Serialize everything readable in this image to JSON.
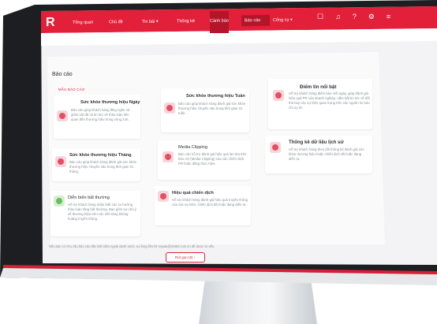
{
  "app": {
    "logo": "R"
  },
  "nav": {
    "items": [
      {
        "label": "Tổng quan"
      },
      {
        "label": "Chủ đề"
      },
      {
        "label": "Tin bài ▾"
      },
      {
        "label": "Thống kê"
      },
      {
        "label": "Cảnh báo"
      },
      {
        "label": "Báo cáo",
        "active": true
      },
      {
        "label": "Công cụ ▾"
      }
    ]
  },
  "page": {
    "title": "Báo cáo",
    "section_label": "MẪU BÁO CÁO"
  },
  "cards": [
    {
      "title": "Sức khỏe thương hiệu Ngày",
      "desc": "Báo cáo giúp khách hàng lắng nghe và giám sát tất cả tin tức về thảo luận liên quan đến thương hiệu trong vòng 24h."
    },
    {
      "title": "Sức khỏe thương hiệu Tuần",
      "desc": "Báo cáo giúp khách hàng đánh giá sức khỏe thương hiệu chuyên sâu trong thời gian 01 tuần."
    },
    {
      "title": "Điểm tin nổi bật",
      "desc": "Hỗ trợ khách hàng điểm báo mỗi ngày, giúp đánh giá hiệu quả PR của doanh nghiệp, nắm bắt tin tức về đối thủ hay các sự kiện quan trọng trên các nguồn tin báo chí uy tín."
    },
    {
      "title": "Sức khỏe thương hiệu Tháng",
      "desc": "Báo cáo giúp khách hàng đánh giá sức khỏe thương hiệu chuyên sâu trong thời gian 01 tháng."
    },
    {
      "title": "Media Clipping",
      "desc": "Báo cáo hỗ trợ đánh giá hiệu quả lan tỏa trên báo chí (Media Clipping) của các chiến dịch PR hoặc đăng thực hiện."
    },
    {
      "title": "Thống kê dữ liệu lịch sử",
      "desc": "Hỗ trợ khách hàng theo dõi thống kê đánh giá sức khỏe thương hiệu hoặc chiến dịch đã hoặc đang diễn ra."
    },
    {
      "title": "Diễn biến bất thường",
      "desc": "Hỗ trợ khách hàng nhận biết các xu hướng thảo luận tăng bất thường. Bao gồm sự chú ý về thương hiệu trên các nền tảng khủng hoảng truyền thông."
    },
    {
      "title": "Hiệu quả chiến dịch",
      "desc": "Hỗ trợ khách hàng đánh giá hiệu quả truyền thông của các sự kiện, chiến dịch đã hoặc đang diễn ra."
    }
  ],
  "footer": {
    "note": "Nếu bạn có nhu cầu báo cáo đặc biệt nằm ngoài danh sách, vui lòng liên hệ reputa@viettel.com.vn để được tư vấn.",
    "button": "Rút gọn (8) ↑"
  }
}
